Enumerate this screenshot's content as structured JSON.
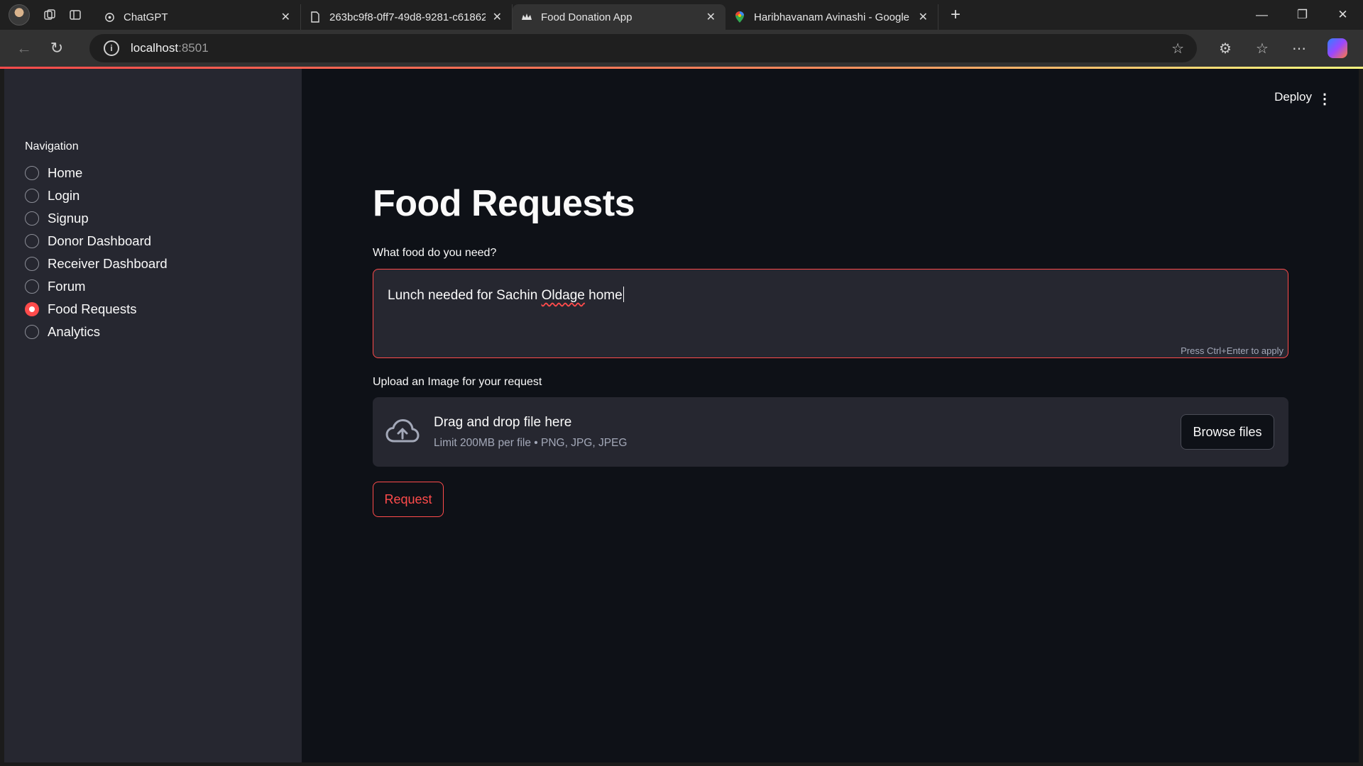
{
  "browser": {
    "tabs": [
      {
        "title": "ChatGPT",
        "icon": "chatgpt-icon",
        "active": false
      },
      {
        "title": "263bc9f8-0ff7-49d8-9281-c61862",
        "icon": "document-icon",
        "active": false
      },
      {
        "title": "Food Donation App",
        "icon": "streamlit-crown-icon",
        "active": true
      },
      {
        "title": "Haribhavanam Avinashi - Google",
        "icon": "maps-pin-icon",
        "active": false
      }
    ],
    "url_host": "localhost",
    "url_port": ":8501"
  },
  "app": {
    "accent_color": "#ff4b4b",
    "header": {
      "deploy_label": "Deploy"
    },
    "sidebar": {
      "title": "Navigation",
      "items": [
        {
          "label": "Home",
          "selected": false
        },
        {
          "label": "Login",
          "selected": false
        },
        {
          "label": "Signup",
          "selected": false
        },
        {
          "label": "Donor Dashboard",
          "selected": false
        },
        {
          "label": "Receiver Dashboard",
          "selected": false
        },
        {
          "label": "Forum",
          "selected": false
        },
        {
          "label": "Food Requests",
          "selected": true
        },
        {
          "label": "Analytics",
          "selected": false
        }
      ]
    },
    "main": {
      "title": "Food Requests",
      "food_label": "What food do you need?",
      "food_value_pre": "Lunch needed for Sachin ",
      "food_value_misspelled": "Oldage",
      "food_value_post": " home",
      "food_hint": "Press Ctrl+Enter to apply",
      "upload_label": "Upload an Image for your request",
      "dropzone_title": "Drag and drop file here",
      "dropzone_limit": "Limit 200MB per file • PNG, JPG, JPEG",
      "browse_label": "Browse files",
      "request_label": "Request"
    }
  }
}
